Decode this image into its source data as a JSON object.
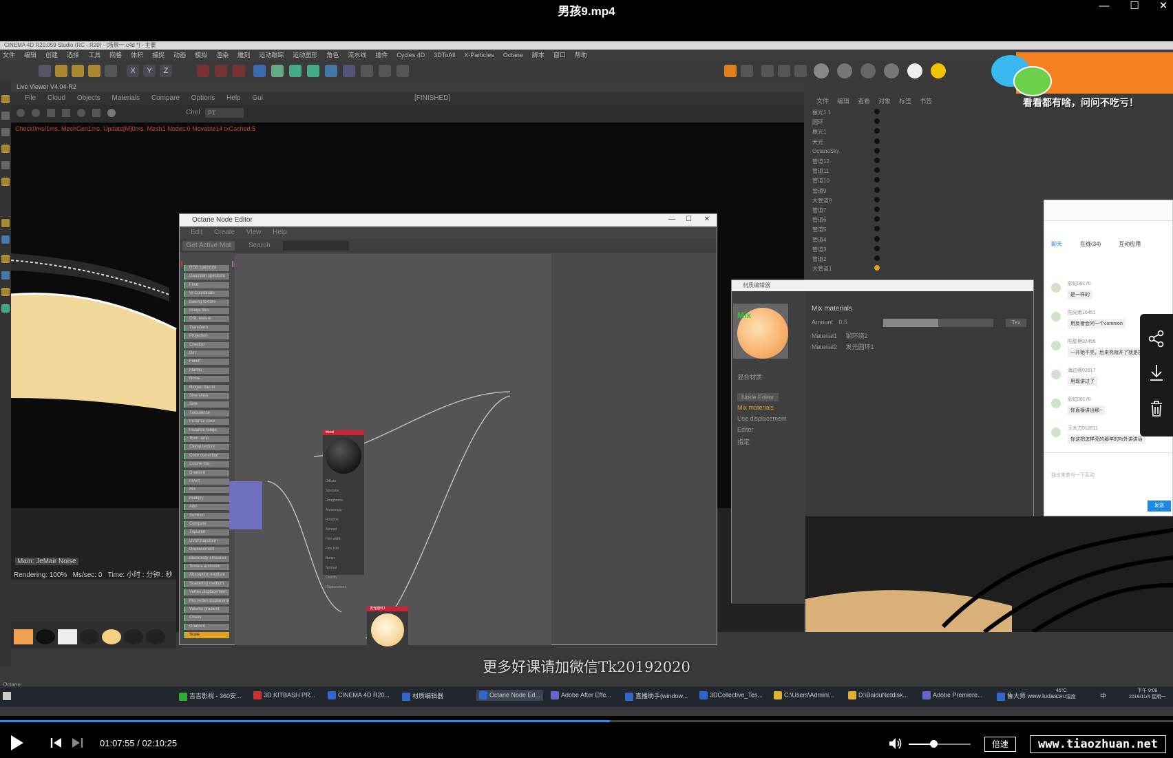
{
  "player": {
    "title": "男孩9.mp4",
    "time": "01:07:55 / 02:10:25",
    "progress": 0.52,
    "volume": 0.4,
    "speed_label": "倍速",
    "watermark": "www.tiaozhuan.net"
  },
  "video": {
    "subtitle": "更多好课请加微信Tk20192020",
    "banner_text": "看看都有啥，问问不吃亏！",
    "c4d": {
      "title": "CINEMA 4D R20.059 Studio (RC - R20) - [场景一.c4d *] - 主要",
      "menu": [
        "文件",
        "编辑",
        "创建",
        "选择",
        "工具",
        "网格",
        "体积",
        "捕捉",
        "动画",
        "模拟",
        "渲染",
        "雕刻",
        "运动跟踪",
        "运动图形",
        "角色",
        "流水线",
        "插件",
        "Cycles 4D",
        "3DToAll",
        "X-Particles",
        "Octane",
        "脚本",
        "窗口",
        "帮助"
      ],
      "live_viewer": {
        "header": "Live Viewer V4.04-R2",
        "menu": [
          "File",
          "Cloud",
          "Objects",
          "Materials",
          "Compare",
          "Options",
          "Help",
          "Gui"
        ],
        "state": "[FINISHED]",
        "channel_label": "Chnl",
        "channel_value": "PT",
        "status_line": "Check0ms/1ms. MeshGen1ms. Update[M]0ms. Mesh1 Nodes:0 Movable14 txCached:5",
        "noise_label": "Main: JeMair Noise",
        "rendering": "Rendering: 100%",
        "ms_sec": "Ms/sec: 0",
        "time_label": "Time: 小时 : 分钟 : 秒"
      },
      "node_editor": {
        "title": "Octane Node Editor",
        "menu": [
          "Edit",
          "Create",
          "View",
          "Help"
        ],
        "get_active_label": "Get Active Mat",
        "search_label": "Search",
        "category_tabs": [
          "Mat",
          "Tex",
          "Gen",
          "Map",
          "Oth",
          "Emi",
          "Med",
          "C4"
        ],
        "list_items": [
          "RGB spectrum",
          "Gaussian spectrum",
          "Float",
          "W Coordinate",
          "Baking texture",
          "Image tiles",
          "OSL texture",
          "Transform",
          "Projection",
          "Checker",
          "Dirt",
          "Falloff",
          "Marble",
          "Noise",
          "Ridged fractal",
          "Sine wave",
          "Side",
          "Turbulence",
          "Instance color",
          "Instance range",
          "Toon ramp",
          "Clamp texture",
          "Color correction",
          "Cosine mix",
          "Gradient",
          "Invert",
          "Mix",
          "Multiply",
          "Add",
          "Subtract",
          "Compare",
          "Triplanar",
          "UVW transform",
          "Displacement",
          "Blackbody emission",
          "Texture emission",
          "Absorption medium",
          "Scattering medium",
          "Vertex displacement",
          "Mix vertex displacement",
          "Volume gradient",
          "Chaos",
          "Gradient",
          "Scale"
        ],
        "metal_node": "Metal",
        "metal_ports": [
          "Diffuse",
          "Specular",
          "Roughness",
          "Anisotropy",
          "Rotation",
          "Spread",
          "Film width",
          "Film IOR",
          "Bump",
          "Normal",
          "Opacity",
          "Displacement"
        ],
        "mix_node": "发光圆环1",
        "emission_node": "Emission"
      },
      "material_editor": {
        "title": "材质编辑器",
        "preview_label": "Mix",
        "section": "Mix materials",
        "amount_label": "Amount",
        "amount_value": "0.5",
        "tex_button": "Tex",
        "material1_label": "Material1",
        "material1_value": "钢环绕2",
        "material2_label": "Material2",
        "material2_value": "发光圆环1",
        "left_items": [
          "混合材质",
          "Node Editor",
          "Mix materials",
          "Use displacement",
          "Editor",
          "指定"
        ]
      },
      "object_manager": {
        "menu": [
          "文件",
          "编辑",
          "查看",
          "对象",
          "标签",
          "书签"
        ],
        "objects": [
          "橡光1.1",
          "圆环",
          "橡光1",
          "天光",
          "OctaneSky",
          "管道12",
          "管道11",
          "管道10",
          "管道9",
          "大管道8",
          "管道7",
          "管道6",
          "管道5",
          "管道4",
          "管道3",
          "管道2",
          "大管道1"
        ]
      },
      "chat": {
        "tabs": [
          "聊天",
          "在线(34)",
          "互动应用"
        ],
        "messages": [
          {
            "user": "彩虹08170",
            "text": "是一样的"
          },
          {
            "user": "阳光雨10451",
            "text": "用反者会问一个common"
          },
          {
            "user": "阳星期92459",
            "text": "一开始不亮，后来亮就开了就是换一组了"
          },
          {
            "user": "海边观02617",
            "text": "用现讲过了"
          },
          {
            "user": "彩虹08170",
            "text": "你直接讲出那~"
          },
          {
            "user": "王大力012011",
            "text": "你这把怎样亮的那年的Ri外讲讲话"
          }
        ],
        "input_placeholder": "我也来参与一下互动",
        "send_label": "发送"
      }
    },
    "taskbar": {
      "items": [
        "吉吉影视 - 360安...",
        "3D KITBASH PR...",
        "CINEMA 4D R20...",
        "材质编辑器",
        "Octane Node Ed...",
        "Adobe After Effe...",
        "直播助手(window...",
        "3DCollective_Tes...",
        "C:\\Users\\Admini...",
        "D:\\BaiduNetdisk...",
        "Adobe Premiere...",
        "鲁大师 www.ludas..."
      ],
      "temp": "45°C",
      "temp_label": "CPU温度",
      "time": "下午 9:08",
      "date": "2019/11/4 星期一",
      "lang": "中"
    },
    "octane_status": "Octane:"
  }
}
